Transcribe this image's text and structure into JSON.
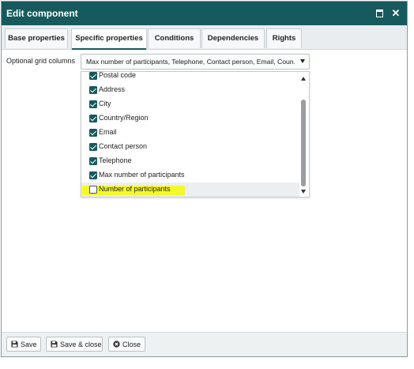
{
  "window": {
    "title": "Edit component",
    "maximize_icon": "maximize-icon",
    "close_icon": "close-icon"
  },
  "tabs": [
    {
      "label": "Base properties",
      "active": false
    },
    {
      "label": "Specific properties",
      "active": true
    },
    {
      "label": "Conditions",
      "active": false
    },
    {
      "label": "Dependencies",
      "active": false
    },
    {
      "label": "Rights",
      "active": false
    }
  ],
  "field": {
    "label": "Optional grid columns",
    "value": "Max number of participants, Telephone, Contact person, Email, Coun..."
  },
  "dropdown": {
    "options": [
      {
        "label": "Postal code",
        "checked": true
      },
      {
        "label": "Address",
        "checked": true
      },
      {
        "label": "City",
        "checked": true
      },
      {
        "label": "Country/Region",
        "checked": true
      },
      {
        "label": "Email",
        "checked": true
      },
      {
        "label": "Contact person",
        "checked": true
      },
      {
        "label": "Telephone",
        "checked": true
      },
      {
        "label": "Max number of participants",
        "checked": true
      },
      {
        "label": "Number of participants",
        "checked": false,
        "highlighted": true
      }
    ]
  },
  "footer": {
    "save_label": "Save",
    "save_close_label": "Save & close",
    "close_label": "Close"
  },
  "colors": {
    "titlebar": "#175a5e",
    "checkbox": "#175a5e",
    "highlight": "#f3f92a"
  }
}
